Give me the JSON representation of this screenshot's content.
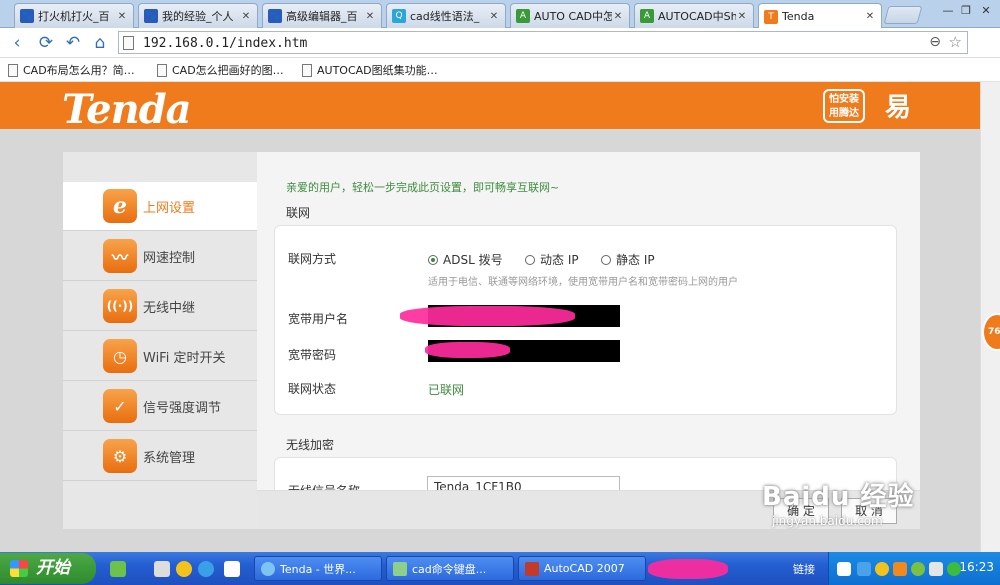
{
  "browser": {
    "tabs": [
      {
        "label": "打火机打火_百",
        "icon_color": "#2a5bb8"
      },
      {
        "label": "我的经验_个人",
        "icon_color": "#2a5bb8"
      },
      {
        "label": "高级编辑器_百",
        "icon_color": "#2a5bb8"
      },
      {
        "label": "cad线性语法_",
        "icon_color": "#2aa6d8"
      },
      {
        "label": "AUTO CAD中怎",
        "icon_color": "#3a9a3a"
      },
      {
        "label": "AUTOCAD中Shi",
        "icon_color": "#3a9a3a"
      },
      {
        "label": "Tenda",
        "icon_color": "#f07b1c"
      }
    ],
    "url": "192.168.0.1/index.htm",
    "bookmarks": [
      "CAD布局怎么用？简…",
      "CAD怎么把画好的图…",
      "AUTOCAD图纸集功能…"
    ]
  },
  "header": {
    "logo": "Tenda",
    "badge1_line1": "怕安装",
    "badge1_line2": "用腾达",
    "badge2": "易"
  },
  "sidebar": {
    "items": [
      {
        "label": "上网设置",
        "icon": "e-icon",
        "glyph": "e"
      },
      {
        "label": "网速控制",
        "icon": "speed-wave-icon",
        "glyph": "M"
      },
      {
        "label": "无线中继",
        "icon": "wireless-relay-icon",
        "glyph": "((·))"
      },
      {
        "label": "WiFi 定时开关",
        "icon": "timer-icon",
        "glyph": "◷"
      },
      {
        "label": "信号强度调节",
        "icon": "signal-check-icon",
        "glyph": "✓"
      },
      {
        "label": "系统管理",
        "icon": "gear-icon",
        "glyph": "⚙"
      }
    ]
  },
  "main": {
    "welcome": "亲爱的用户，轻松一步完成此页设置，即可畅享互联网~",
    "net_section": "联网",
    "conn_label": "联网方式",
    "conn_options": [
      "ADSL 拨号",
      "动态 IP",
      "静态 IP"
    ],
    "conn_hint": "适用于电信、联通等网络环境，使用宽带用户名和宽带密码上网的用户",
    "user_label": "宽带用户名",
    "pass_label": "宽带密码",
    "status_label": "联网状态",
    "status_value": "已联网",
    "wifi_section": "无线加密",
    "ssid_label": "无线信号名称",
    "ssid_value": "Tenda_1CF1B0",
    "ok_button": "确 定",
    "cancel_button": "取 消"
  },
  "watermark": {
    "text": "Baidu 经验",
    "sub": "jingyan.baidu.com"
  },
  "float_badge": "76",
  "taskbar": {
    "start_label": "开始",
    "tasks": [
      "Tenda - 世界...",
      "cad命令键盘...",
      "AutoCAD 2007"
    ],
    "tray_text": "链接",
    "clock": "16:23"
  }
}
